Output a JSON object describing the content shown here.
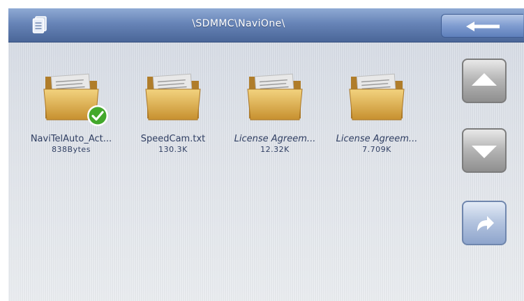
{
  "header": {
    "path": "\\SDMMC\\NaviOne\\",
    "doc_icon": "document-icon",
    "back_icon": "back-arrow-icon"
  },
  "files": [
    {
      "name": "NaviTelAuto_Act...",
      "size": "838Bytes",
      "selected": true
    },
    {
      "name": "SpeedCam.txt",
      "size": "130.3K",
      "selected": false
    },
    {
      "name": "License Agreem...",
      "size": "12.32K",
      "selected": false
    },
    {
      "name": "License Agreem...",
      "size": "7.709K",
      "selected": false
    }
  ],
  "side_buttons": {
    "scroll_up_icon": "triangle-up-icon",
    "scroll_down_icon": "triangle-down-icon",
    "open_icon": "curved-arrow-icon"
  },
  "colors": {
    "header": "#6784b7",
    "folder": "#d9a84a",
    "check": "#43a82c",
    "text": "#2f3e62"
  }
}
